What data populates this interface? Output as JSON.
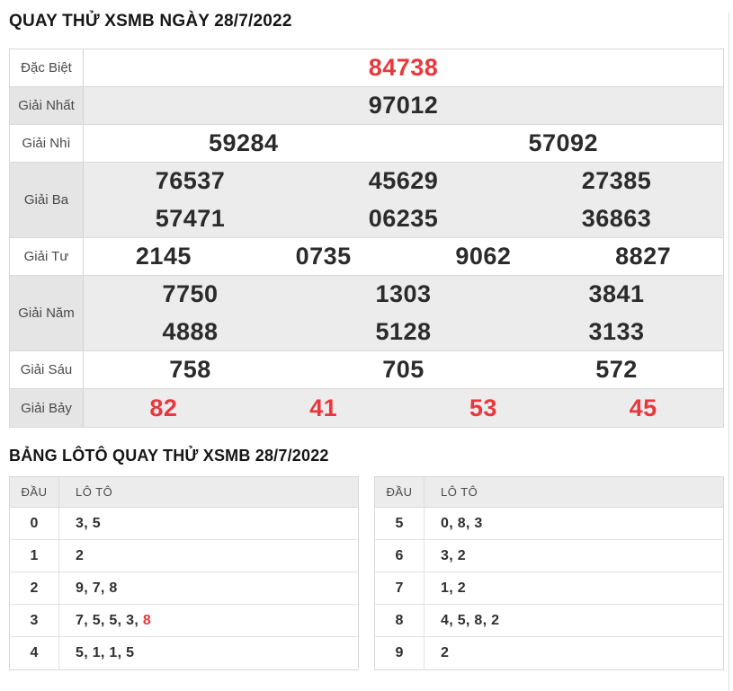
{
  "colors": {
    "accent_red": "#e8383e",
    "striped_row_bg": "#ececec",
    "border": "#d9d9d9",
    "number_text": "#2b2b2b",
    "label_text": "#4a4a4a"
  },
  "results": {
    "title": "QUAY THỬ XSMB NGÀY 28/7/2022",
    "rows": [
      {
        "label": "Đặc Biệt",
        "values": [
          "84738"
        ],
        "highlight": true
      },
      {
        "label": "Giải Nhất",
        "values": [
          "97012"
        ]
      },
      {
        "label": "Giải Nhì",
        "values": [
          "59284",
          "57092"
        ]
      },
      {
        "label": "Giải Ba",
        "values": [
          "76537",
          "45629",
          "27385",
          "57471",
          "06235",
          "36863"
        ]
      },
      {
        "label": "Giải Tư",
        "values": [
          "2145",
          "0735",
          "9062",
          "8827"
        ]
      },
      {
        "label": "Giải Năm",
        "values": [
          "7750",
          "1303",
          "3841",
          "4888",
          "5128",
          "3133"
        ]
      },
      {
        "label": "Giải Sáu",
        "values": [
          "758",
          "705",
          "572"
        ]
      },
      {
        "label": "Giải Bảy",
        "values": [
          "82",
          "41",
          "53",
          "45"
        ],
        "highlight": true
      }
    ]
  },
  "loto": {
    "title": "BẢNG LÔTÔ QUAY THỬ XSMB 28/7/2022",
    "col_dau": "ĐẦU",
    "col_loto": "LÔ TÔ",
    "left": [
      {
        "dau": "0",
        "values": [
          "3",
          "5"
        ]
      },
      {
        "dau": "1",
        "values": [
          "2"
        ]
      },
      {
        "dau": "2",
        "values": [
          "9",
          "7",
          "8"
        ]
      },
      {
        "dau": "3",
        "values": [
          "7",
          "5",
          "5",
          "3",
          "8"
        ],
        "red_indices": [
          4
        ]
      },
      {
        "dau": "4",
        "values": [
          "5",
          "1",
          "1",
          "5"
        ]
      }
    ],
    "right": [
      {
        "dau": "5",
        "values": [
          "0",
          "8",
          "3"
        ]
      },
      {
        "dau": "6",
        "values": [
          "3",
          "2"
        ]
      },
      {
        "dau": "7",
        "values": [
          "1",
          "2"
        ]
      },
      {
        "dau": "8",
        "values": [
          "4",
          "5",
          "8",
          "2"
        ]
      },
      {
        "dau": "9",
        "values": [
          "2"
        ]
      }
    ]
  }
}
